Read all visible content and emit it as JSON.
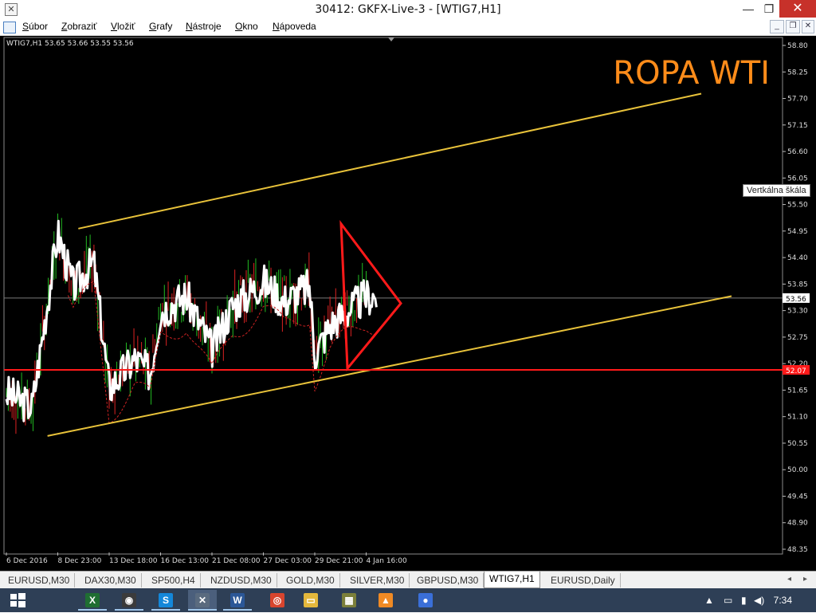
{
  "window": {
    "title": "30412: GKFX-Live-3 - [WTIG7,H1]",
    "minimize": "—",
    "maximize": "❐",
    "close": "✕"
  },
  "menu": {
    "items": [
      {
        "acc": "S",
        "rest": "úbor"
      },
      {
        "acc": "Z",
        "rest": "obraziť"
      },
      {
        "acc": "V",
        "rest": "ložiť"
      },
      {
        "acc": "G",
        "rest": "rafy"
      },
      {
        "acc": "N",
        "rest": "ástroje"
      },
      {
        "acc": "O",
        "rest": "kno"
      },
      {
        "acc": "N",
        "rest": "ápoveda"
      }
    ]
  },
  "chart": {
    "info": "WTIG7,H1  53.65 53.66 53.55 53.56",
    "label": "ROPA WTI",
    "tooltip": "Vertkálna škála",
    "price_ticks": [
      "58.80",
      "58.25",
      "57.70",
      "57.15",
      "56.60",
      "56.05",
      "55.50",
      "54.95",
      "54.40",
      "53.85",
      "53.30",
      "52.75",
      "52.20",
      "51.65",
      "51.10",
      "50.55",
      "50.00",
      "49.45",
      "48.90",
      "48.35"
    ],
    "current_price": "53.56",
    "support_price": "52.07",
    "time_labels": [
      "6 Dec 2016",
      "8 Dec 23:00",
      "13 Dec 18:00",
      "16 Dec 13:00",
      "21 Dec 08:00",
      "27 Dec 03:00",
      "29 Dec 21:00",
      "4 Jan 16:00"
    ],
    "colors": {
      "background": "#000000",
      "channel": "#e8c23a",
      "support": "#ff1a1a",
      "bull": "#22bb22",
      "bear": "#dd2222",
      "price_line": "#ffffff",
      "label": "#ff8c1a"
    },
    "chart_data": {
      "type": "line",
      "title": "ROPA WTI",
      "xlabel": "",
      "ylabel": "",
      "ylim": [
        48.35,
        58.8
      ],
      "x": [
        "6 Dec 2016",
        "8 Dec 23:00",
        "13 Dec 18:00",
        "16 Dec 13:00",
        "21 Dec 08:00",
        "27 Dec 03:00",
        "29 Dec 21:00",
        "4 Jan 16:00"
      ],
      "series": [
        {
          "values": [
            51.6,
            54.9,
            51.7,
            53.3,
            52.5,
            53.9,
            52.4,
            53.6
          ]
        }
      ],
      "lines": {
        "upper_channel": [
          55.0,
          57.8
        ],
        "lower_channel": [
          50.7,
          53.6
        ],
        "support": 52.07,
        "current": 53.56
      }
    }
  },
  "tabs": {
    "items": [
      "EURUSD,M30",
      "DAX30,M30",
      "SP500,H4",
      "NZDUSD,M30",
      "GOLD,M30",
      "SILVER,M30",
      "GBPUSD,M30",
      "WTIG7,H1",
      "EURUSD,Daily"
    ],
    "active": "WTIG7,H1",
    "left": "◂",
    "right": "▸"
  },
  "taskbar": {
    "apps": [
      {
        "name": "file-explorer-icon",
        "color": "#1f6e32",
        "glyph": "X"
      },
      {
        "name": "xbox-icon",
        "color": "#3b3b3b",
        "glyph": "◉"
      },
      {
        "name": "skype-icon",
        "color": "#1487d9",
        "glyph": "S"
      },
      {
        "name": "metatrader-icon",
        "color": "#5a6b7f",
        "glyph": "✕"
      },
      {
        "name": "word-icon",
        "color": "#2b5797",
        "glyph": "W"
      },
      {
        "name": "chrome-icon",
        "color": "#d8452e",
        "glyph": "◎"
      },
      {
        "name": "folder-icon",
        "color": "#e4b83c",
        "glyph": "▭"
      },
      {
        "name": "photos-icon",
        "color": "#7b7f3a",
        "glyph": "▦"
      },
      {
        "name": "vlc-icon",
        "color": "#f08a24",
        "glyph": "▲"
      },
      {
        "name": "app-icon",
        "color": "#3a6fd8",
        "glyph": "●"
      }
    ],
    "clock": "7:34",
    "tray": [
      "▲",
      "▭",
      "▮",
      "◀)"
    ]
  }
}
